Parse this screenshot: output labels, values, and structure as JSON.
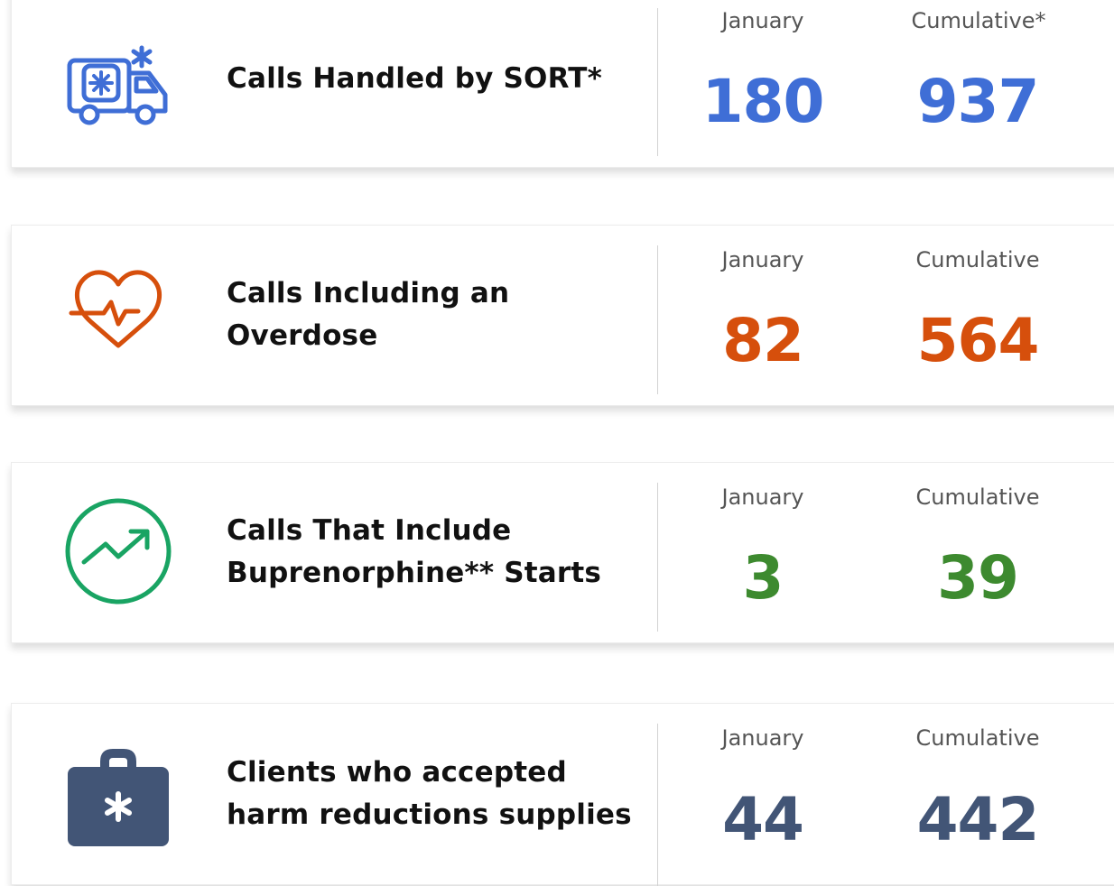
{
  "colors": {
    "blue": "#3f6ed6",
    "orange": "#d64f0c",
    "green": "#3d8a2f",
    "navy": "#425576",
    "icon_green": "#19a463"
  },
  "cards": [
    {
      "icon": "ambulance-icon",
      "label_lines": [
        "Calls Handled by SORT*"
      ],
      "month_header": "January",
      "cumulative_header": "Cumulative*",
      "month_value": "180",
      "cumulative_value": "937"
    },
    {
      "icon": "heart-pulse-icon",
      "label_lines": [
        "Calls Including an",
        "Overdose"
      ],
      "month_header": "January",
      "cumulative_header": "Cumulative",
      "month_value": "82",
      "cumulative_value": "564"
    },
    {
      "icon": "trending-up-icon",
      "label_lines": [
        "Calls That Include",
        "Buprenorphine** Starts"
      ],
      "month_header": "January",
      "cumulative_header": "Cumulative",
      "month_value": "3",
      "cumulative_value": "39"
    },
    {
      "icon": "medical-kit-icon",
      "label_lines": [
        "Clients who accepted",
        "harm reductions supplies"
      ],
      "month_header": "January",
      "cumulative_header": "Cumulative",
      "month_value": "44",
      "cumulative_value": "442"
    }
  ]
}
